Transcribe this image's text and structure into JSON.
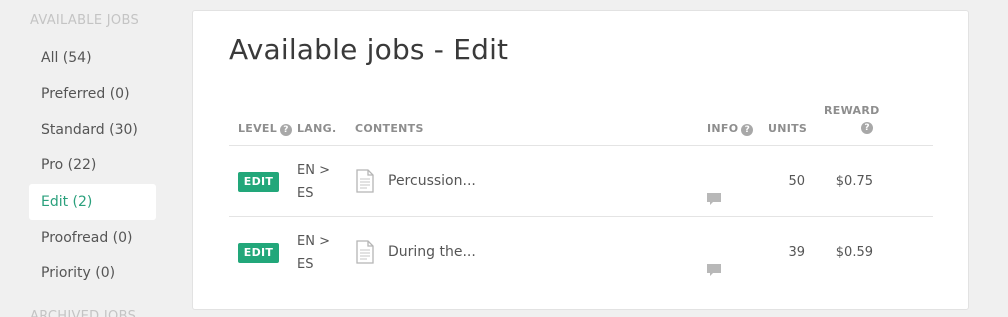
{
  "sidebar": {
    "heading": "AVAILABLE JOBS",
    "items": [
      {
        "label": "All (54)",
        "active": false
      },
      {
        "label": "Preferred (0)",
        "active": false
      },
      {
        "label": "Standard (30)",
        "active": false
      },
      {
        "label": "Pro (22)",
        "active": false
      },
      {
        "label": "Edit (2)",
        "active": true
      },
      {
        "label": "Proofread (0)",
        "active": false
      },
      {
        "label": "Priority (0)",
        "active": false
      }
    ],
    "archived_heading": "ARCHIVED JOBS"
  },
  "main": {
    "title": "Available jobs - Edit",
    "columns": {
      "level": "LEVEL",
      "lang": "LANG.",
      "contents": "CONTENTS",
      "info": "INFO",
      "units": "UNITS",
      "reward": "REWARD",
      "help": "?"
    },
    "rows": [
      {
        "level": "EDIT",
        "lang_from": "EN >",
        "lang_to": "ES",
        "content": "Percussion...",
        "units": "50",
        "reward": "$0.75"
      },
      {
        "level": "EDIT",
        "lang_from": "EN >",
        "lang_to": "ES",
        "content": "During the...",
        "units": "39",
        "reward": "$0.59"
      }
    ]
  },
  "colors": {
    "accent": "#2aa07c",
    "badge": "#22a77a",
    "background": "#f0f0f0"
  },
  "icons": {
    "help": "question-circle-icon",
    "document": "document-icon",
    "info": "comment-bubble-icon"
  }
}
